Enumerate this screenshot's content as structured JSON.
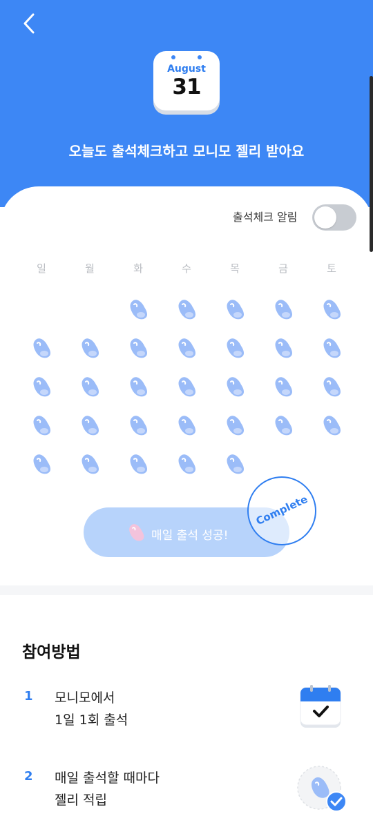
{
  "header": {
    "back_icon": "chevron-left-icon",
    "month": "August",
    "day": "31",
    "message": "오늘도 출석체크하고 모니모 젤리 받아요",
    "background_color": "#3d87f5"
  },
  "attendance": {
    "alarm_label": "출석체크 알림",
    "alarm_on": false,
    "weekdays": [
      "일",
      "월",
      "화",
      "수",
      "목",
      "금",
      "토"
    ],
    "jelly_icon": "jelly-icon",
    "jelly_color": "#9bbcf8",
    "checked_days": 31,
    "success_button_label": "매일 출석 성공!",
    "stamp_text": "Complete"
  },
  "how_to": {
    "title": "참여방법",
    "steps": [
      {
        "num": "1",
        "line1": "모니모에서",
        "line2": "1일 1회 출석",
        "icon": "calendar-check-icon"
      },
      {
        "num": "2",
        "line1": "매일 출석할 때마다",
        "line2": "젤리 적립",
        "icon": "jelly-check-icon"
      }
    ]
  },
  "colors": {
    "accent": "#2f7ef0",
    "button_disabled": "#b7d3fb"
  }
}
